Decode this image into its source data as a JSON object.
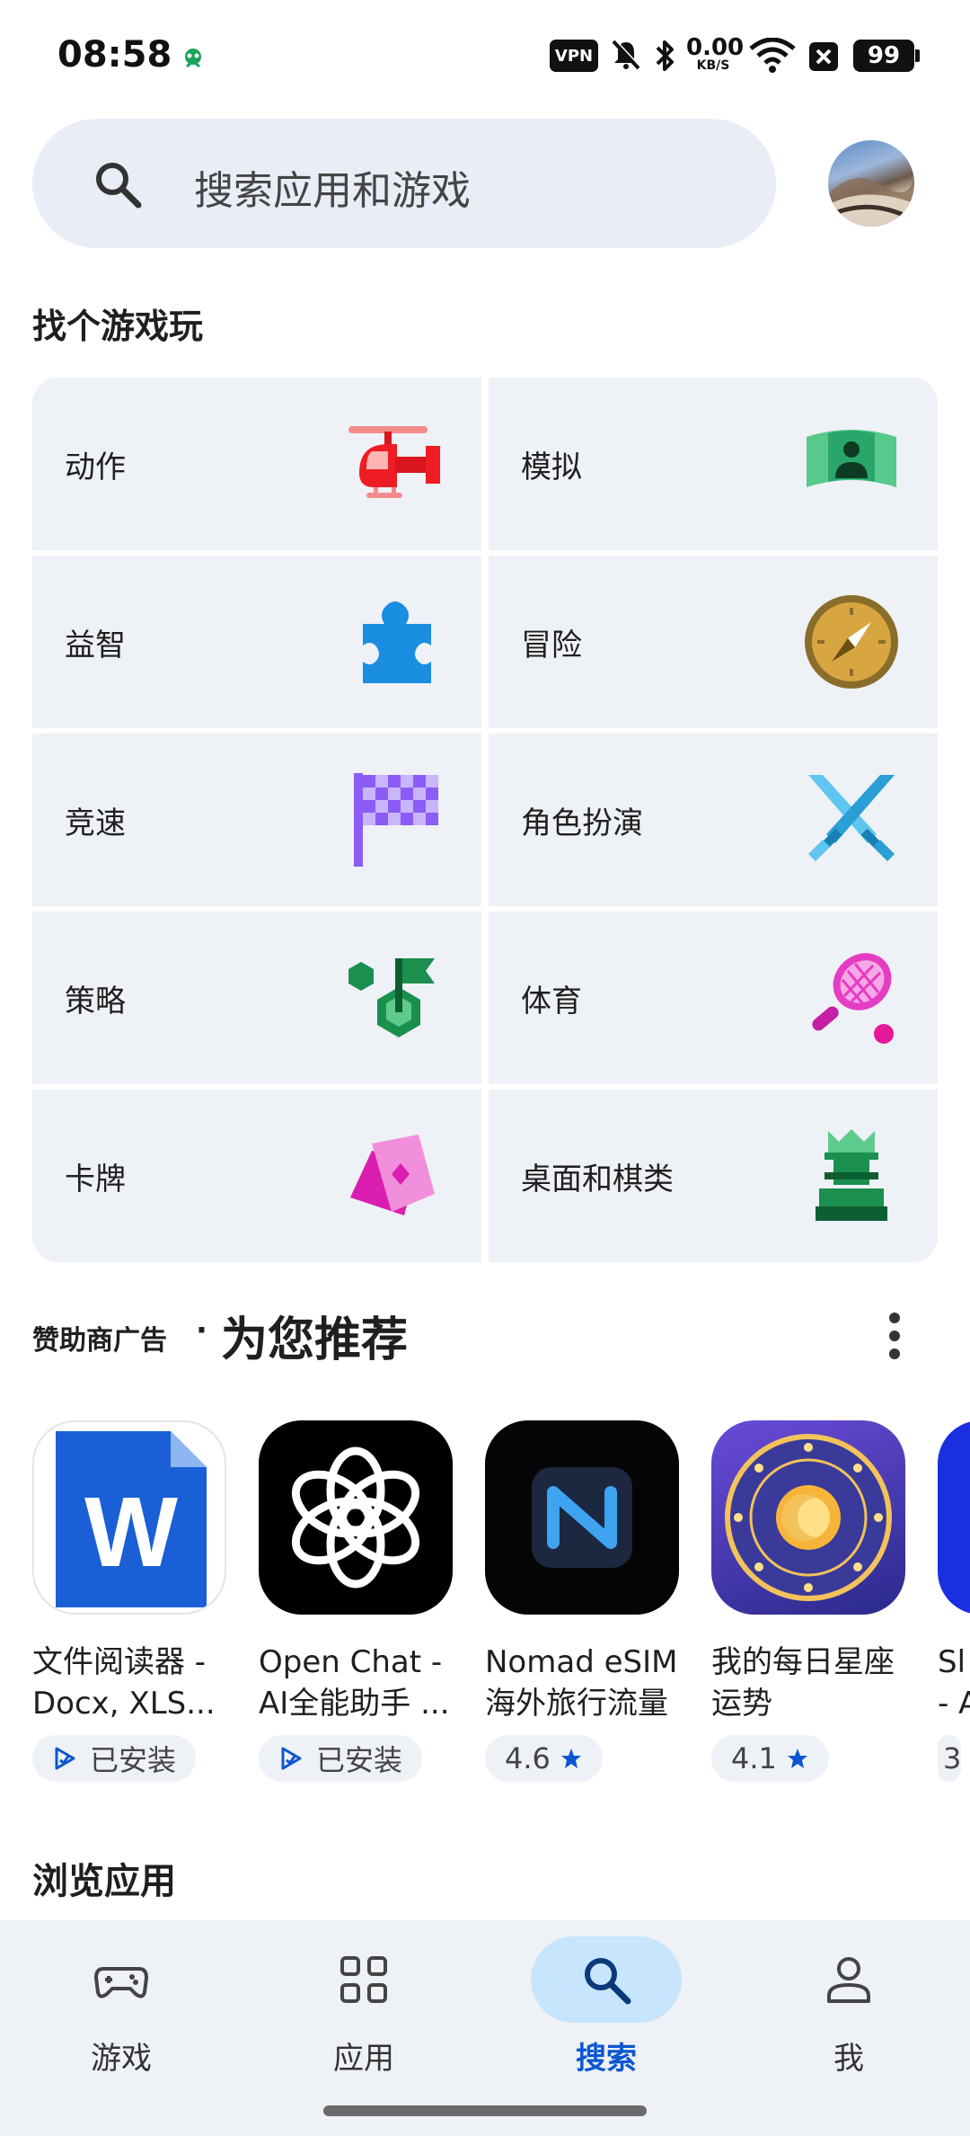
{
  "status_bar": {
    "time": "08:58",
    "vpn": "VPN",
    "speed_value": "0.00",
    "speed_unit": "KB/S",
    "battery": "99",
    "icons": [
      "bug-icon",
      "vpn-icon",
      "mute-icon",
      "bluetooth-icon",
      "wifi-icon",
      "close-box-icon",
      "battery-icon"
    ]
  },
  "search": {
    "placeholder": "搜索应用和游戏"
  },
  "games_section": {
    "title": "找个游戏玩",
    "categories": [
      {
        "label": "动作",
        "icon": "helicopter-icon"
      },
      {
        "label": "模拟",
        "icon": "simulation-icon"
      },
      {
        "label": "益智",
        "icon": "puzzle-icon"
      },
      {
        "label": "冒险",
        "icon": "compass-icon"
      },
      {
        "label": "竞速",
        "icon": "checkered-flag-icon"
      },
      {
        "label": "角色扮演",
        "icon": "crossed-swords-icon"
      },
      {
        "label": "策略",
        "icon": "strategy-flag-icon"
      },
      {
        "label": "体育",
        "icon": "tennis-racket-icon"
      },
      {
        "label": "卡牌",
        "icon": "cards-icon"
      },
      {
        "label": "桌面和棋类",
        "icon": "chess-rook-icon"
      }
    ]
  },
  "recommended": {
    "sponsored_label": "赞助商广告",
    "separator": "·",
    "title": "为您推荐",
    "apps": [
      {
        "name_line1": "文件阅读器 -",
        "name_line2": "Docx, XLS...",
        "badge": "已安装",
        "icon": "word-doc-icon"
      },
      {
        "name_line1": "Open Chat -",
        "name_line2": "AI全能助手 ...",
        "badge": "已安装",
        "icon": "openai-knot-icon"
      },
      {
        "name_line1": "Nomad eSIM",
        "name_line2": "海外旅行流量",
        "badge": "4.6",
        "icon": "nomad-esim-icon"
      },
      {
        "name_line1": "我的每日星座",
        "name_line2": "运势",
        "badge": "4.1",
        "icon": "zodiac-wheel-icon"
      },
      {
        "name_line1": "Sl",
        "name_line2": "- A",
        "badge": "3",
        "icon": "partial-app-icon"
      }
    ]
  },
  "browse": {
    "title": "浏览应用"
  },
  "bottom_nav": {
    "items": [
      {
        "label": "游戏",
        "icon": "gamepad-icon",
        "active": false
      },
      {
        "label": "应用",
        "icon": "apps-grid-icon",
        "active": false
      },
      {
        "label": "搜索",
        "icon": "search-icon",
        "active": true
      },
      {
        "label": "我",
        "icon": "person-icon",
        "active": false
      }
    ]
  },
  "colors": {
    "accent": "#0b57d0",
    "active_pill": "#c7e5fd",
    "card_bg": "#eef1f6",
    "search_bg": "#e9edf5"
  }
}
